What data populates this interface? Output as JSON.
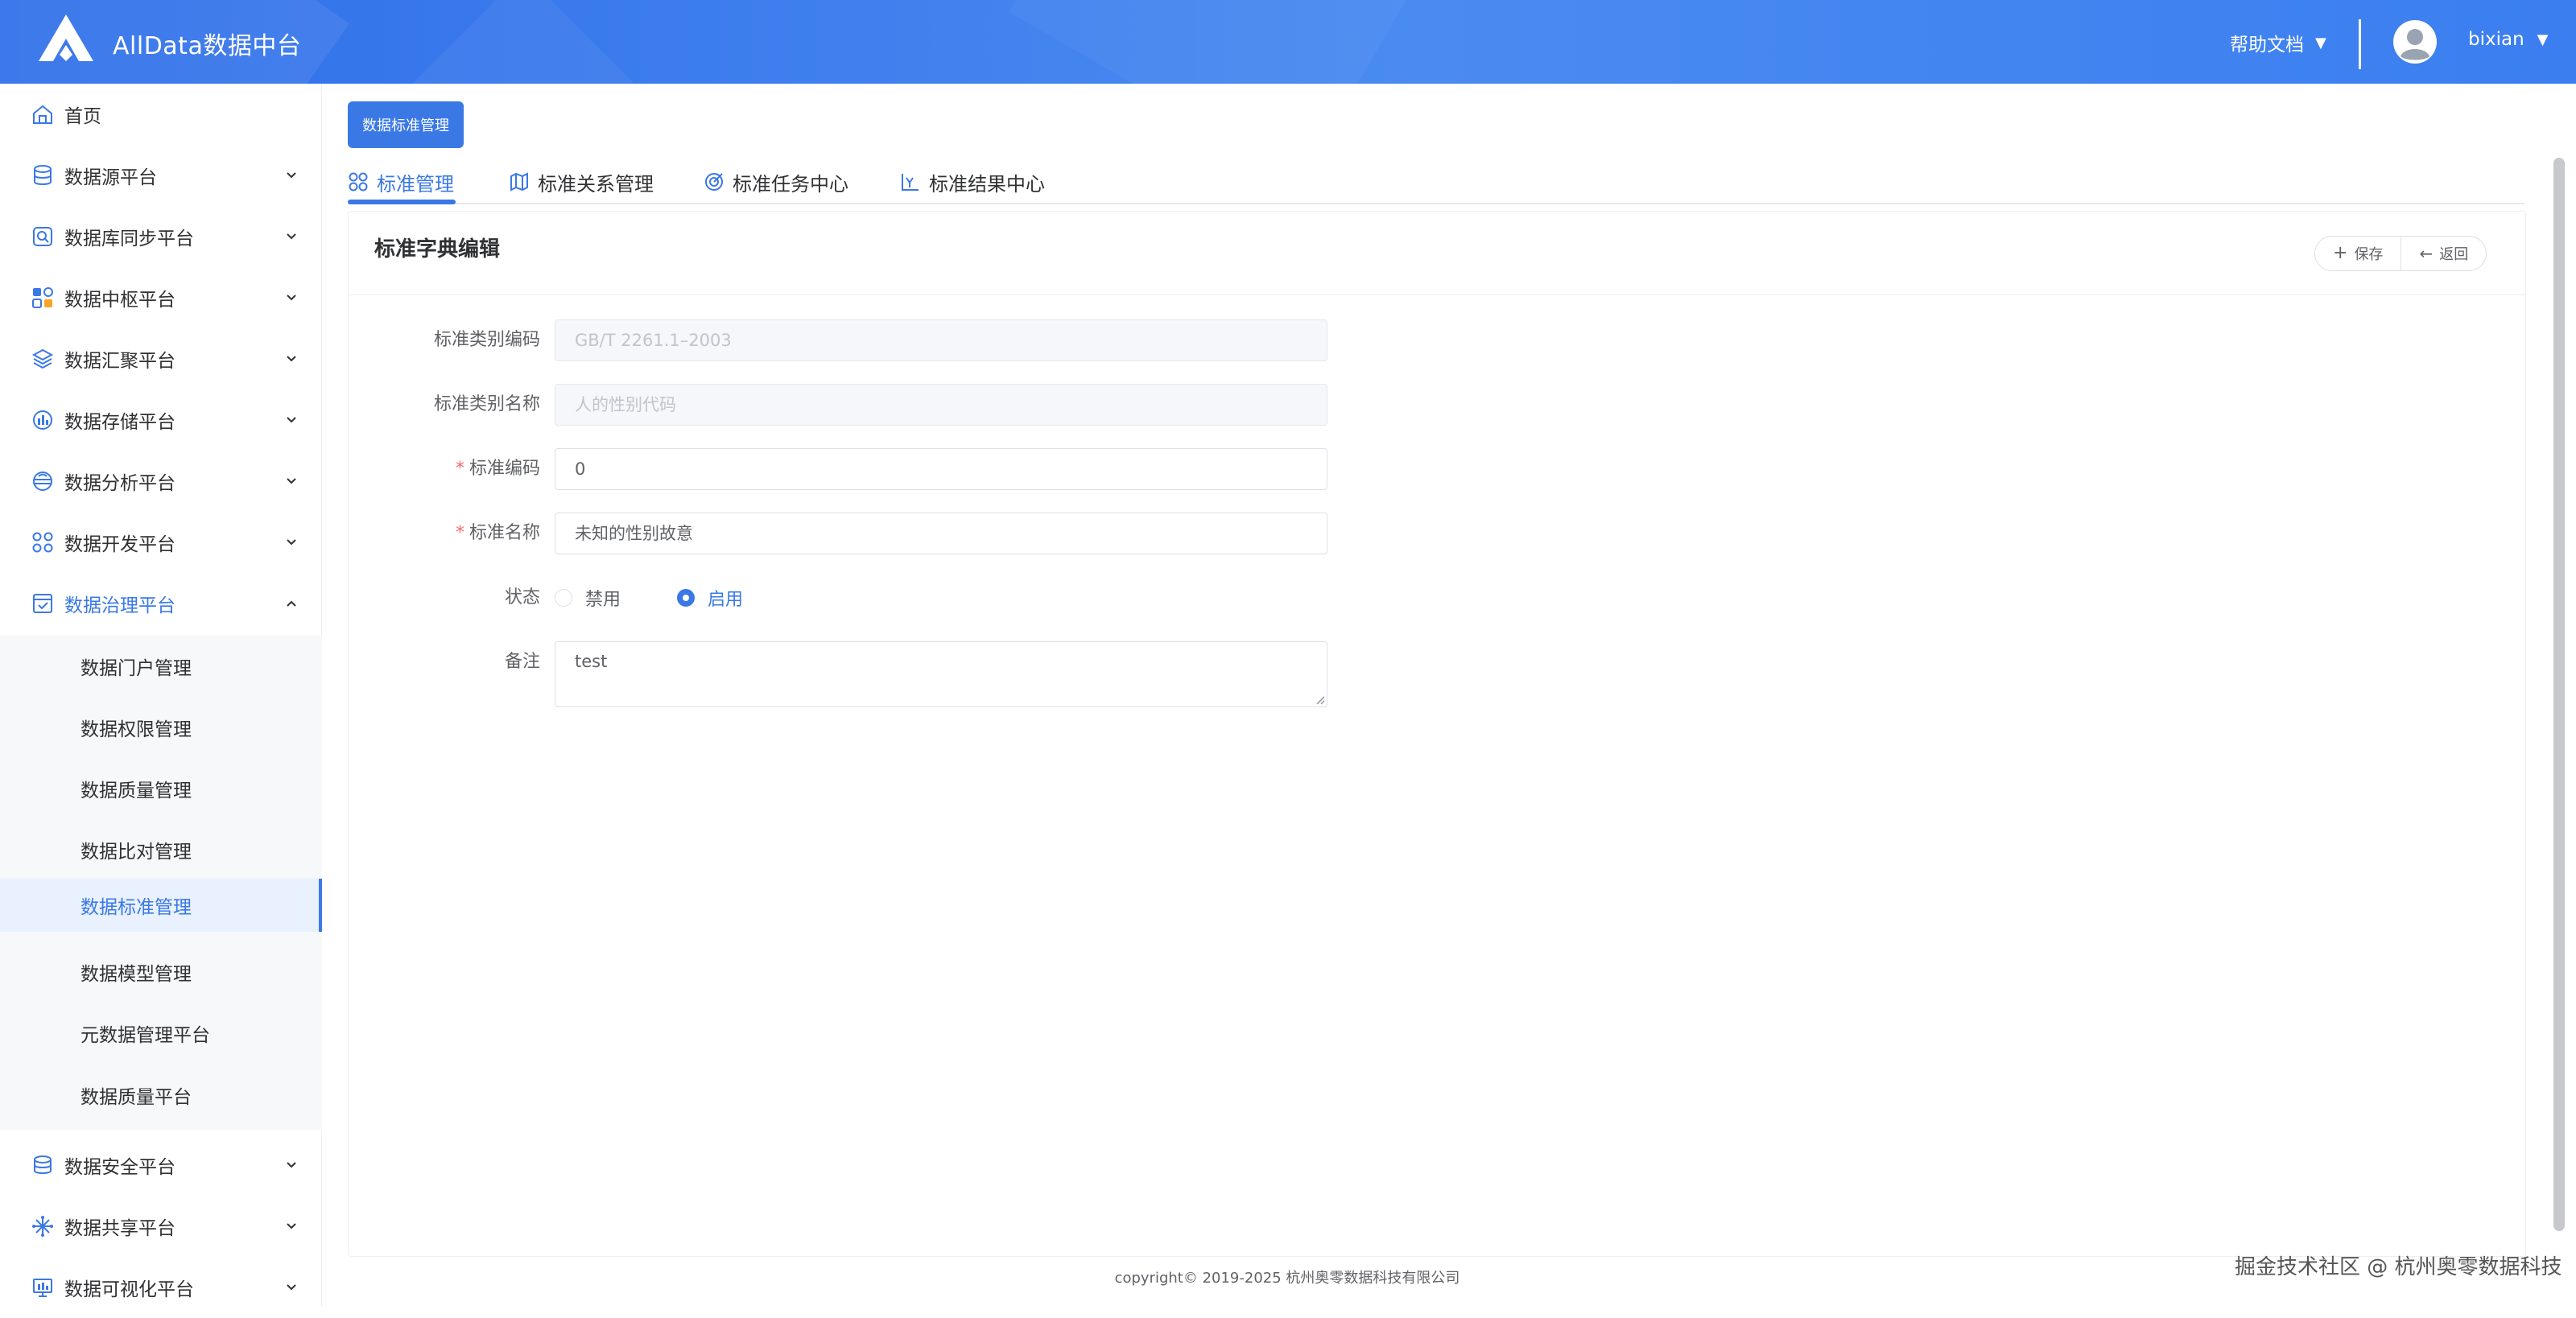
{
  "header": {
    "app_title": "AllData数据中台",
    "help_label": "帮助文档",
    "username": "bixian",
    "caret": "▼"
  },
  "sidebar": {
    "top_items": [
      {
        "label": "首页",
        "icon": "home-icon"
      },
      {
        "label": "数据源平台",
        "icon": "database-icon"
      },
      {
        "label": "数据库同步平台",
        "icon": "sync-icon"
      },
      {
        "label": "数据中枢平台",
        "icon": "grid-icon"
      },
      {
        "label": "数据汇聚平台",
        "icon": "layers-icon"
      },
      {
        "label": "数据存储平台",
        "icon": "storage-icon"
      },
      {
        "label": "数据分析平台",
        "icon": "analysis-icon"
      },
      {
        "label": "数据开发平台",
        "icon": "dev-icon"
      },
      {
        "label": "数据治理平台",
        "icon": "governance-icon"
      }
    ],
    "sub_items": [
      {
        "label": "数据门户管理"
      },
      {
        "label": "数据权限管理"
      },
      {
        "label": "数据质量管理"
      },
      {
        "label": "数据比对管理"
      },
      {
        "label": "数据标准管理"
      },
      {
        "label": "数据模型管理"
      },
      {
        "label": "元数据管理平台"
      },
      {
        "label": "数据质量平台"
      }
    ],
    "bottom_items": [
      {
        "label": "数据安全平台",
        "icon": "security-icon"
      },
      {
        "label": "数据共享平台",
        "icon": "share-icon"
      },
      {
        "label": "数据可视化平台",
        "icon": "visualization-icon"
      }
    ]
  },
  "main": {
    "tag_button": "数据标准管理",
    "tabs": [
      {
        "label": "标准管理",
        "icon": "apps-icon"
      },
      {
        "label": "标准关系管理",
        "icon": "map-icon"
      },
      {
        "label": "标准任务中心",
        "icon": "target-icon"
      },
      {
        "label": "标准结果中心",
        "icon": "result-icon"
      }
    ],
    "card_title": "标准字典编辑",
    "save_label": "保存",
    "back_label": "返回",
    "form": {
      "type_code_label": "标准类别编码",
      "type_code_value": "GB/T 2261.1–2003",
      "type_name_label": "标准类别名称",
      "type_name_value": "人的性别代码",
      "code_label": "标准编码",
      "code_value": "0",
      "name_label": "标准名称",
      "name_value": "未知的性别故意",
      "status_label": "状态",
      "status_options": [
        "禁用",
        "启用"
      ],
      "status_selected": "启用",
      "remark_label": "备注",
      "remark_value": "test",
      "required_mark": "*"
    }
  },
  "footer": {
    "copyright": "copyright© 2019-2025 杭州奥零数据科技有限公司",
    "watermark": "掘金技术社区 @ 杭州奥零数据科技"
  },
  "colors": {
    "accent": "#3a78e6",
    "header_gradient_start": "#2f6fe9",
    "header_gradient_end": "#3b7ef0",
    "required": "#f56c6c"
  }
}
